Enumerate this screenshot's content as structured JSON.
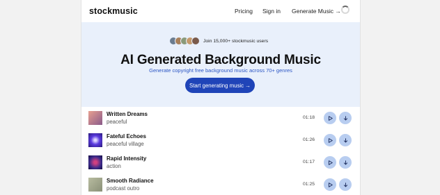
{
  "brand": "stockmusic",
  "nav": {
    "pricing": "Pricing",
    "signin": "Sign in",
    "cta": "Generate Music →"
  },
  "hero": {
    "social_text": "Join 15,000+ stockmusic users",
    "title": "AI Generated Background Music",
    "subtitle": "Generate copyright free background music across 70+ genres",
    "button": "Start generating music →",
    "avatar_colors": [
      "#6b7c8f",
      "#a8805a",
      "#8a9a7a",
      "#c49a6c",
      "#7a5a4a"
    ]
  },
  "tracks": [
    {
      "title": "Written Dreams",
      "tag": "peaceful",
      "duration": "01:18",
      "art": "#c98a7a"
    },
    {
      "title": "Fateful Echoes",
      "tag": "peaceful village",
      "duration": "01:26",
      "art": "#4b38c9"
    },
    {
      "title": "Rapid Intensity",
      "tag": "action",
      "duration": "01:17",
      "art": "#3a2a8a"
    },
    {
      "title": "Smooth Radiance",
      "tag": "podcast outro",
      "duration": "01:25",
      "art": "#a3a88a"
    }
  ],
  "icons": {
    "play": "play-icon",
    "download": "download-icon",
    "loading": "loading-spinner"
  },
  "colors": {
    "accent": "#1f44b8",
    "hero_bg": "#e9f0fb",
    "button_light": "#b8cdf0"
  }
}
